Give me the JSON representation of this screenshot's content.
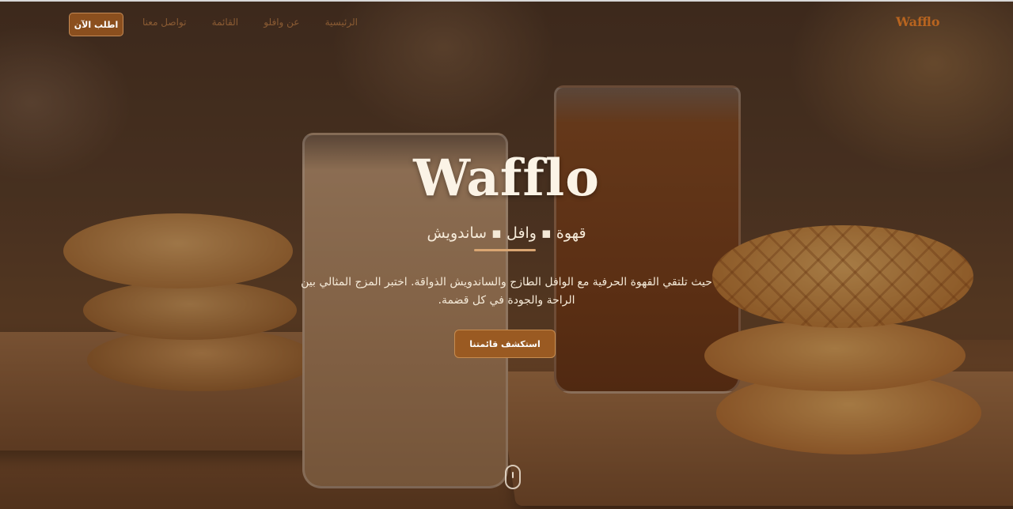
{
  "nav": {
    "brand": "Wafflo",
    "links": [
      {
        "label": "الرئيسية"
      },
      {
        "label": "عن وافلو"
      },
      {
        "label": "القائمة"
      },
      {
        "label": "تواصل معنا"
      }
    ],
    "order_button": "اطلب الآن"
  },
  "hero": {
    "title": "Wafflo",
    "subtitle": "قهوة ▪ وافل ▪ ساندويش",
    "description": "حيث تلتقي القهوة الحرفية مع الوافل الطازج والساندويش الذواقة. اختبر المزج المثالي بين الراحة والجودة في كل قضمة.",
    "cta_label": "استكشف قائمتنا"
  },
  "colors": {
    "accent": "#9a5a22",
    "brand": "#b8641f",
    "text_light": "#f5ead8"
  }
}
